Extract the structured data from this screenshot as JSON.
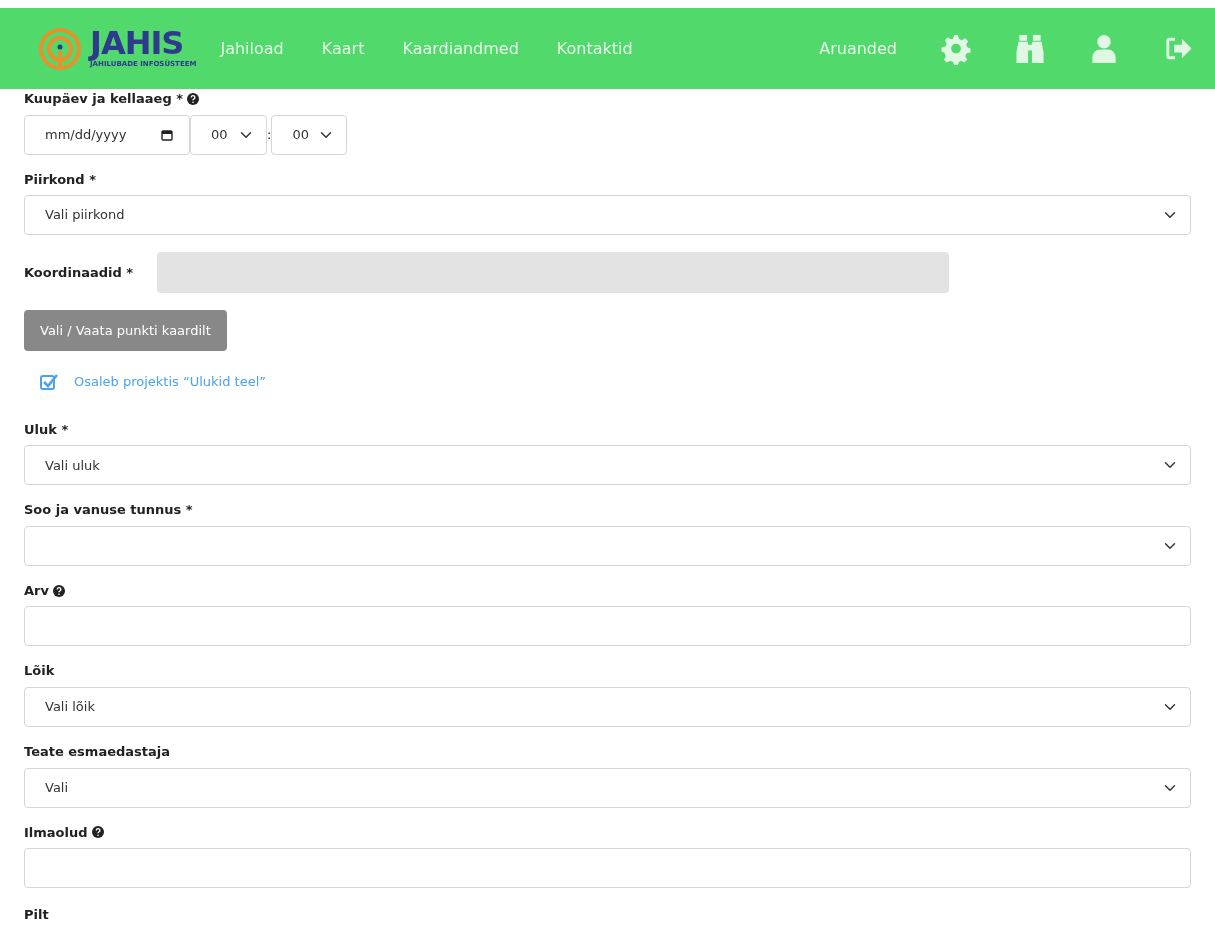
{
  "navbar": {
    "logo": {
      "title": "JAHIS",
      "subtitle": "JAHILUBADE INFOSÜSTEEM"
    },
    "links": [
      {
        "label": "Jahiload"
      },
      {
        "label": "Kaart"
      },
      {
        "label": "Kaardiandmed"
      },
      {
        "label": "Kontaktid"
      }
    ],
    "right_link": {
      "label": "Aruanded"
    }
  },
  "form": {
    "datetime": {
      "label": "Kuupäev ja kellaaeg *",
      "help": true,
      "date_value": "mm/dd/yyyy",
      "hour": "00",
      "separator": ":",
      "minute": "00"
    },
    "fields": [
      {
        "kind": "select",
        "label": "Piirkond *",
        "help": false,
        "value": "Vali piirkond"
      },
      {
        "kind": "readonly",
        "label": "Koordinaadid *"
      },
      {
        "kind": "button",
        "label": "Vali / Vaata punkti kaardilt"
      },
      {
        "kind": "checkbox",
        "label": "Osaleb projektis “Ulukid teel”",
        "checked": true
      },
      {
        "kind": "select",
        "label": "Uluk *",
        "help": false,
        "value": "Vali uluk"
      },
      {
        "kind": "select",
        "label": "Soo ja vanuse tunnus *",
        "help": false
      },
      {
        "kind": "input",
        "label": "Arv",
        "help": true
      },
      {
        "kind": "select",
        "label": "Lõik",
        "help": false,
        "value": "Vali lõik"
      },
      {
        "kind": "select",
        "label": "Teate esmaedastaja",
        "help": false,
        "value": "Vali"
      },
      {
        "kind": "input",
        "label": "Ilmaolud",
        "help": true
      },
      {
        "kind": "label",
        "label": "Pilt"
      }
    ]
  }
}
